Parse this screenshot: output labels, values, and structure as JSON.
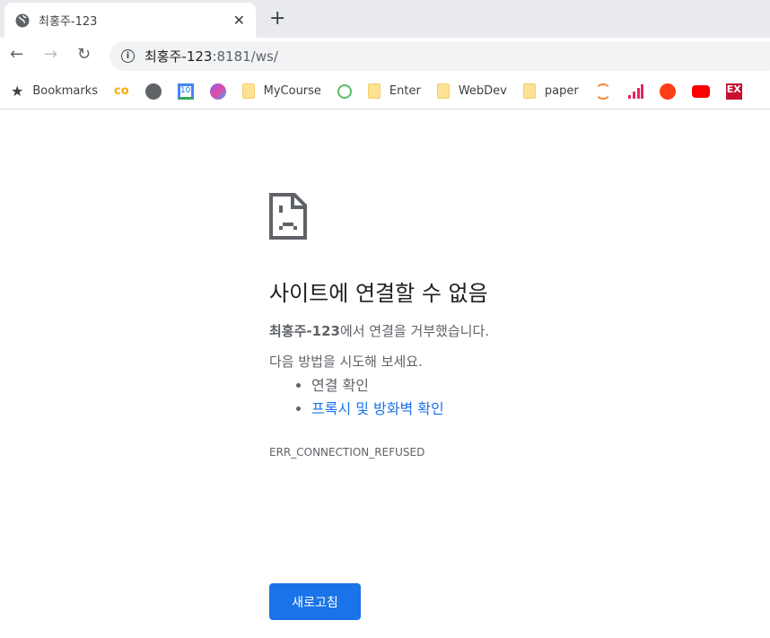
{
  "tab": {
    "title": "최홍주-123",
    "close": "✕",
    "new_tab": "+"
  },
  "nav": {
    "back": "←",
    "forward": "→",
    "reload": "↻"
  },
  "omnibox": {
    "host": "최홍주-123",
    "rest": ":8181/ws/"
  },
  "bookmarks": [
    {
      "label": "Bookmarks",
      "icon": "star-icon"
    },
    {
      "label": "",
      "icon": "colab-icon"
    },
    {
      "label": "",
      "icon": "globe-icon"
    },
    {
      "label": "",
      "icon": "calendar-icon"
    },
    {
      "label": "",
      "icon": "copilot-icon"
    },
    {
      "label": "MyCourse",
      "icon": "folder-icon"
    },
    {
      "label": "",
      "icon": "green-clock-icon"
    },
    {
      "label": "Enter",
      "icon": "folder-icon"
    },
    {
      "label": "WebDev",
      "icon": "folder-icon"
    },
    {
      "label": "paper",
      "icon": "folder-icon"
    },
    {
      "label": "",
      "icon": "orange-arc-icon"
    },
    {
      "label": "",
      "icon": "bar-chart-icon"
    },
    {
      "label": "",
      "icon": "red-circle-icon"
    },
    {
      "label": "",
      "icon": "youtube-icon"
    },
    {
      "label": "",
      "icon": "ex-icon"
    }
  ],
  "error": {
    "heading": "사이트에 연결할 수 없음",
    "host": "최홍주-123",
    "refused": "에서 연결을 거부했습니다.",
    "try": "다음 방법을 시도해 보세요.",
    "suggestions": [
      "연결 확인",
      "프록시 및 방화벽 확인"
    ],
    "code": "ERR_CONNECTION_REFUSED",
    "reload": "새로고침"
  },
  "colors": {
    "accent": "#1a73e8"
  }
}
